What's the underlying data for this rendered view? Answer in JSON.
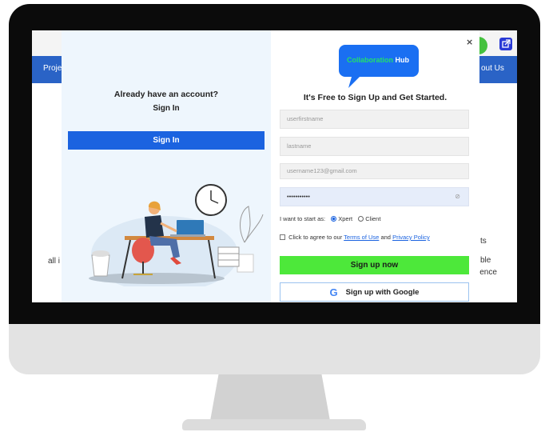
{
  "background_page": {
    "nav_left": "Proje",
    "nav_right": "out Us",
    "side_left": "all i",
    "side_right": [
      "ts",
      "ble",
      "ience"
    ]
  },
  "modal": {
    "left": {
      "heading": "Already have an account?",
      "signin_link": "Sign In",
      "signin_button": "Sign In"
    },
    "right": {
      "close": "×",
      "logo_word1": "Collaboration",
      "logo_word2": "Hub",
      "tagline": "It's Free to Sign Up and Get Started.",
      "fields": {
        "firstname_placeholder": "userfirstname",
        "lastname_placeholder": "lastname",
        "email_placeholder": "username123@gmail.com",
        "password_value": "•••••••••••"
      },
      "start_as_label": "I want to start as:",
      "options": [
        "Xpert",
        "Client"
      ],
      "selected_option": "Xpert",
      "terms_prefix": "Click to agree to our",
      "terms_link": "Terms of Use",
      "terms_and": "and",
      "privacy_link": "Privacy Policy",
      "signup_button": "Sign up now",
      "google_button": "Sign up with Google"
    }
  },
  "colors": {
    "nav": "#2a63c6",
    "primary": "#1b63e0",
    "signup": "#4de83a",
    "logo_bubble": "#1a6ff2",
    "logo_green": "#22e06a"
  }
}
